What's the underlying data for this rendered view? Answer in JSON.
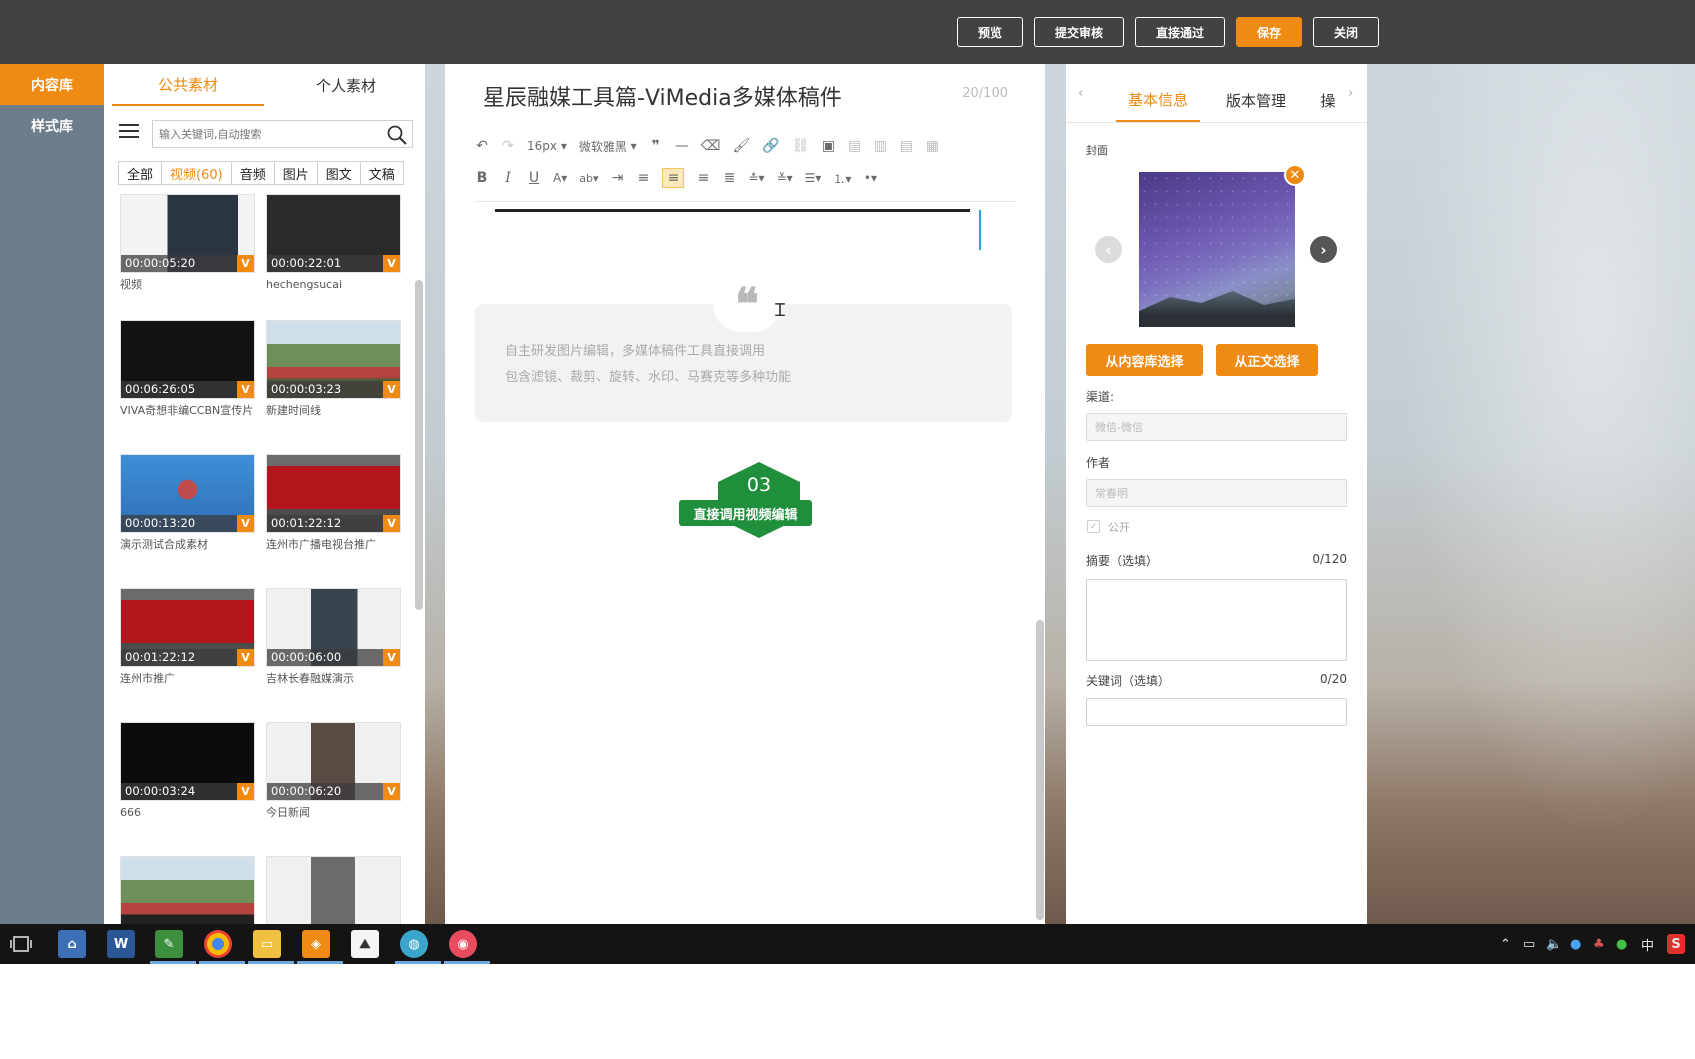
{
  "topbar": {
    "buttons": [
      {
        "label": "预览"
      },
      {
        "label": "提交审核"
      },
      {
        "label": "直接通过"
      },
      {
        "label": "保存"
      },
      {
        "label": "关闭"
      }
    ]
  },
  "leftnav": {
    "items": [
      {
        "label": "内容库"
      },
      {
        "label": "样式库"
      }
    ]
  },
  "material": {
    "tabs": [
      {
        "label": "公共素材"
      },
      {
        "label": "个人素材"
      }
    ],
    "search_placeholder": "输入关键词,自动搜索",
    "filters": [
      {
        "label": "全部"
      },
      {
        "label": "视频(60)"
      },
      {
        "label": "音频"
      },
      {
        "label": "图片"
      },
      {
        "label": "图文"
      },
      {
        "label": "文稿"
      }
    ],
    "badge": "V",
    "items": [
      {
        "time": "00:00:05:20",
        "name": "视频"
      },
      {
        "time": "00:00:22:01",
        "name": "hechengsucai"
      },
      {
        "time": "00:06:26:05",
        "name": "VIVA奇想非编CCBN宣传片"
      },
      {
        "time": "00:00:03:23",
        "name": "新建时间线"
      },
      {
        "time": "00:00:13:20",
        "name": "演示测试合成素材"
      },
      {
        "time": "00:01:22:12",
        "name": "连州市广播电视台推广"
      },
      {
        "time": "00:01:22:12",
        "name": "连州市推广"
      },
      {
        "time": "00:00:06:00",
        "name": "吉林长春融媒演示"
      },
      {
        "time": "00:00:03:24",
        "name": "666"
      },
      {
        "time": "00:00:06:20",
        "name": "今日新闻"
      }
    ]
  },
  "editor": {
    "title": "星辰融媒工具篇-ViMedia多媒体稿件",
    "title_count": "20/100",
    "font_size": "16px",
    "font_family": "微软雅黑",
    "quote_lines": [
      "自主研发图片编辑，多媒体稿件工具直接调用",
      "包含滤镜、裁剪、旋转、水印、马赛克等多种功能"
    ],
    "step_number": "03",
    "step_label": "直接调用视频编辑"
  },
  "rightpanel": {
    "tabs": [
      {
        "label": "基本信息"
      },
      {
        "label": "版本管理"
      },
      {
        "label": "操"
      }
    ],
    "cover_label": "封面",
    "from_library": "从内容库选择",
    "from_body": "从正文选择",
    "channel_label": "渠道:",
    "channel_value": "微信-微信",
    "author_label": "作者",
    "author_value": "常春明",
    "public_label": "公开",
    "summary_label": "摘要（选填）",
    "summary_count": "0/120",
    "keyword_label": "关键词（选填）",
    "keyword_count": "0/20"
  },
  "taskbar": {
    "tray_lang": "中",
    "tray_s": "S"
  },
  "colors": {
    "accent": "#ef8a12",
    "topbar": "#424242",
    "green": "#1f8f3c",
    "caret": "#2aa0dc"
  }
}
